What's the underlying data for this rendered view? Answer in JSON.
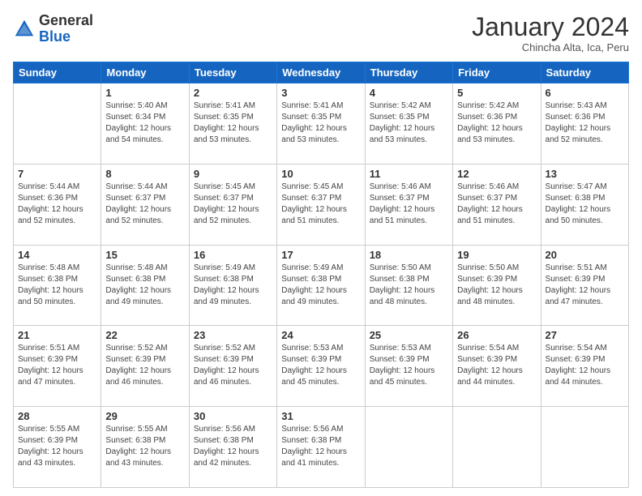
{
  "header": {
    "logo_general": "General",
    "logo_blue": "Blue",
    "month": "January 2024",
    "location": "Chincha Alta, Ica, Peru"
  },
  "days_of_week": [
    "Sunday",
    "Monday",
    "Tuesday",
    "Wednesday",
    "Thursday",
    "Friday",
    "Saturday"
  ],
  "weeks": [
    [
      {
        "day": "",
        "info": ""
      },
      {
        "day": "1",
        "info": "Sunrise: 5:40 AM\nSunset: 6:34 PM\nDaylight: 12 hours\nand 54 minutes."
      },
      {
        "day": "2",
        "info": "Sunrise: 5:41 AM\nSunset: 6:35 PM\nDaylight: 12 hours\nand 53 minutes."
      },
      {
        "day": "3",
        "info": "Sunrise: 5:41 AM\nSunset: 6:35 PM\nDaylight: 12 hours\nand 53 minutes."
      },
      {
        "day": "4",
        "info": "Sunrise: 5:42 AM\nSunset: 6:35 PM\nDaylight: 12 hours\nand 53 minutes."
      },
      {
        "day": "5",
        "info": "Sunrise: 5:42 AM\nSunset: 6:36 PM\nDaylight: 12 hours\nand 53 minutes."
      },
      {
        "day": "6",
        "info": "Sunrise: 5:43 AM\nSunset: 6:36 PM\nDaylight: 12 hours\nand 52 minutes."
      }
    ],
    [
      {
        "day": "7",
        "info": "Sunrise: 5:44 AM\nSunset: 6:36 PM\nDaylight: 12 hours\nand 52 minutes."
      },
      {
        "day": "8",
        "info": "Sunrise: 5:44 AM\nSunset: 6:37 PM\nDaylight: 12 hours\nand 52 minutes."
      },
      {
        "day": "9",
        "info": "Sunrise: 5:45 AM\nSunset: 6:37 PM\nDaylight: 12 hours\nand 52 minutes."
      },
      {
        "day": "10",
        "info": "Sunrise: 5:45 AM\nSunset: 6:37 PM\nDaylight: 12 hours\nand 51 minutes."
      },
      {
        "day": "11",
        "info": "Sunrise: 5:46 AM\nSunset: 6:37 PM\nDaylight: 12 hours\nand 51 minutes."
      },
      {
        "day": "12",
        "info": "Sunrise: 5:46 AM\nSunset: 6:37 PM\nDaylight: 12 hours\nand 51 minutes."
      },
      {
        "day": "13",
        "info": "Sunrise: 5:47 AM\nSunset: 6:38 PM\nDaylight: 12 hours\nand 50 minutes."
      }
    ],
    [
      {
        "day": "14",
        "info": "Sunrise: 5:48 AM\nSunset: 6:38 PM\nDaylight: 12 hours\nand 50 minutes."
      },
      {
        "day": "15",
        "info": "Sunrise: 5:48 AM\nSunset: 6:38 PM\nDaylight: 12 hours\nand 49 minutes."
      },
      {
        "day": "16",
        "info": "Sunrise: 5:49 AM\nSunset: 6:38 PM\nDaylight: 12 hours\nand 49 minutes."
      },
      {
        "day": "17",
        "info": "Sunrise: 5:49 AM\nSunset: 6:38 PM\nDaylight: 12 hours\nand 49 minutes."
      },
      {
        "day": "18",
        "info": "Sunrise: 5:50 AM\nSunset: 6:38 PM\nDaylight: 12 hours\nand 48 minutes."
      },
      {
        "day": "19",
        "info": "Sunrise: 5:50 AM\nSunset: 6:39 PM\nDaylight: 12 hours\nand 48 minutes."
      },
      {
        "day": "20",
        "info": "Sunrise: 5:51 AM\nSunset: 6:39 PM\nDaylight: 12 hours\nand 47 minutes."
      }
    ],
    [
      {
        "day": "21",
        "info": "Sunrise: 5:51 AM\nSunset: 6:39 PM\nDaylight: 12 hours\nand 47 minutes."
      },
      {
        "day": "22",
        "info": "Sunrise: 5:52 AM\nSunset: 6:39 PM\nDaylight: 12 hours\nand 46 minutes."
      },
      {
        "day": "23",
        "info": "Sunrise: 5:52 AM\nSunset: 6:39 PM\nDaylight: 12 hours\nand 46 minutes."
      },
      {
        "day": "24",
        "info": "Sunrise: 5:53 AM\nSunset: 6:39 PM\nDaylight: 12 hours\nand 45 minutes."
      },
      {
        "day": "25",
        "info": "Sunrise: 5:53 AM\nSunset: 6:39 PM\nDaylight: 12 hours\nand 45 minutes."
      },
      {
        "day": "26",
        "info": "Sunrise: 5:54 AM\nSunset: 6:39 PM\nDaylight: 12 hours\nand 44 minutes."
      },
      {
        "day": "27",
        "info": "Sunrise: 5:54 AM\nSunset: 6:39 PM\nDaylight: 12 hours\nand 44 minutes."
      }
    ],
    [
      {
        "day": "28",
        "info": "Sunrise: 5:55 AM\nSunset: 6:39 PM\nDaylight: 12 hours\nand 43 minutes."
      },
      {
        "day": "29",
        "info": "Sunrise: 5:55 AM\nSunset: 6:38 PM\nDaylight: 12 hours\nand 43 minutes."
      },
      {
        "day": "30",
        "info": "Sunrise: 5:56 AM\nSunset: 6:38 PM\nDaylight: 12 hours\nand 42 minutes."
      },
      {
        "day": "31",
        "info": "Sunrise: 5:56 AM\nSunset: 6:38 PM\nDaylight: 12 hours\nand 41 minutes."
      },
      {
        "day": "",
        "info": ""
      },
      {
        "day": "",
        "info": ""
      },
      {
        "day": "",
        "info": ""
      }
    ]
  ]
}
